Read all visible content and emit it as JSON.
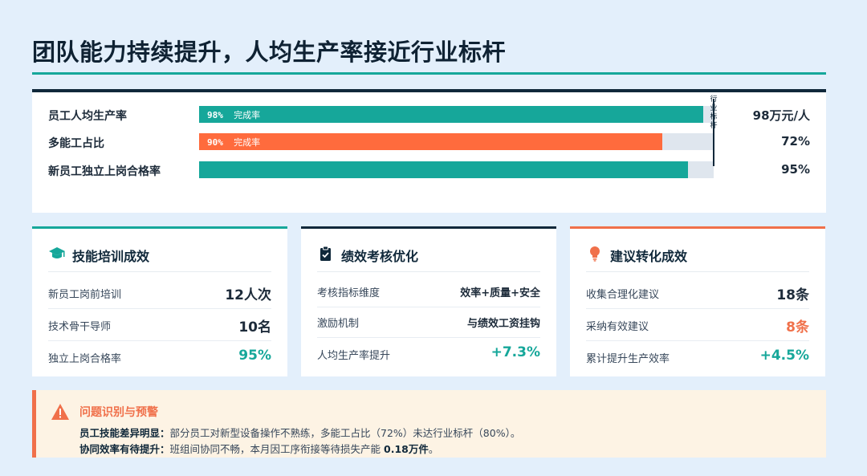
{
  "page": {
    "title": "团队能力持续提升，人均生产率接近行业标杆"
  },
  "kpi": {
    "benchmark_label": "行业标杆",
    "rows": [
      {
        "label": "员工人均生产率",
        "fill_pct": 98,
        "fill_percent_text": "98%",
        "fill_suffix": "完成率",
        "value": "98万元/人",
        "color": "#16a79a"
      },
      {
        "label": "多能工占比",
        "fill_pct": 90,
        "fill_percent_text": "90%",
        "fill_suffix": "完成率",
        "value": "72%",
        "color": "#ff6b3d"
      },
      {
        "label": "新员工独立上岗合格率",
        "fill_pct": 95,
        "fill_percent_text": "",
        "fill_suffix": "",
        "value": "95%",
        "color": "#16a79a"
      }
    ]
  },
  "cards": {
    "training": {
      "title": "技能培训成效",
      "icon": "graduation-cap-icon",
      "rows": [
        {
          "label": "新员工岗前培训",
          "value": "12人次"
        },
        {
          "label": "技术骨干导师",
          "value": "10名"
        },
        {
          "label": "独立上岗合格率",
          "value": "95%"
        }
      ]
    },
    "performance": {
      "title": "绩效考核优化",
      "icon": "clipboard-check-icon",
      "rows": [
        {
          "label": "考核指标维度",
          "value": "效率+质量+安全"
        },
        {
          "label": "激励机制",
          "value": "与绩效工资挂钩"
        },
        {
          "label": "人均生产率提升",
          "value": "+7.3%"
        }
      ]
    },
    "suggestions": {
      "title": "建议转化成效",
      "icon": "lightbulb-icon",
      "rows": [
        {
          "label": "收集合理化建议",
          "value": "18条"
        },
        {
          "label": "采纳有效建议",
          "value": "8条"
        },
        {
          "label": "累计提升生产效率",
          "value": "+4.5%"
        }
      ]
    }
  },
  "alert": {
    "title": "问题识别与预警",
    "icon": "warning-triangle-icon",
    "items": [
      {
        "label": "员工技能差异明显：",
        "text": "部分员工对新型设备操作不熟练，多能工占比（72%）未达行业标杆（80%）。"
      },
      {
        "label": "协同效率有待提升：",
        "text": "班组间协同不畅，本月因工序衔接等待损失产能 ",
        "highlight": "0.18万件",
        "tail": "。"
      }
    ]
  },
  "colors": {
    "teal": "#16a79a",
    "navy": "#10283a",
    "orange": "#f0704a",
    "background": "#e3effb"
  }
}
